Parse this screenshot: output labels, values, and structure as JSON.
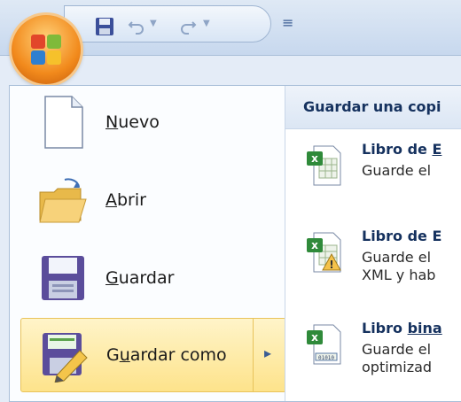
{
  "menu": {
    "items": [
      {
        "label": "Nuevo",
        "accel": "N",
        "rest": "uevo"
      },
      {
        "label": "Abrir",
        "accel": "A",
        "rest": "brir"
      },
      {
        "label": "Guardar",
        "accel": "G",
        "rest": "uardar"
      },
      {
        "label": "Guardar como",
        "pre": "G",
        "accel": "u",
        "rest": "ardar como"
      }
    ],
    "submenu_arrow": "▸"
  },
  "right_panel": {
    "heading": "Guardar una copi",
    "items": [
      {
        "title_pre": "Libro de ",
        "title_accel": "E",
        "desc_lines": [
          "Guarde el"
        ]
      },
      {
        "title_pre": "Libro de E",
        "title_accel": "",
        "desc_lines": [
          "Guarde el",
          "XML y hab"
        ]
      },
      {
        "title_pre": "Libro ",
        "title_accel": "bina",
        "desc_lines": [
          "Guarde el",
          "optimizad"
        ]
      }
    ]
  },
  "qat": {
    "save_icon": "save-icon",
    "undo_icon": "undo-icon",
    "redo_icon": "redo-icon",
    "customize_icon": "customize-icon"
  },
  "colors": {
    "selected_bg": "#fde38b",
    "heading_text": "#15315e",
    "frame": "#a9bfd9"
  }
}
